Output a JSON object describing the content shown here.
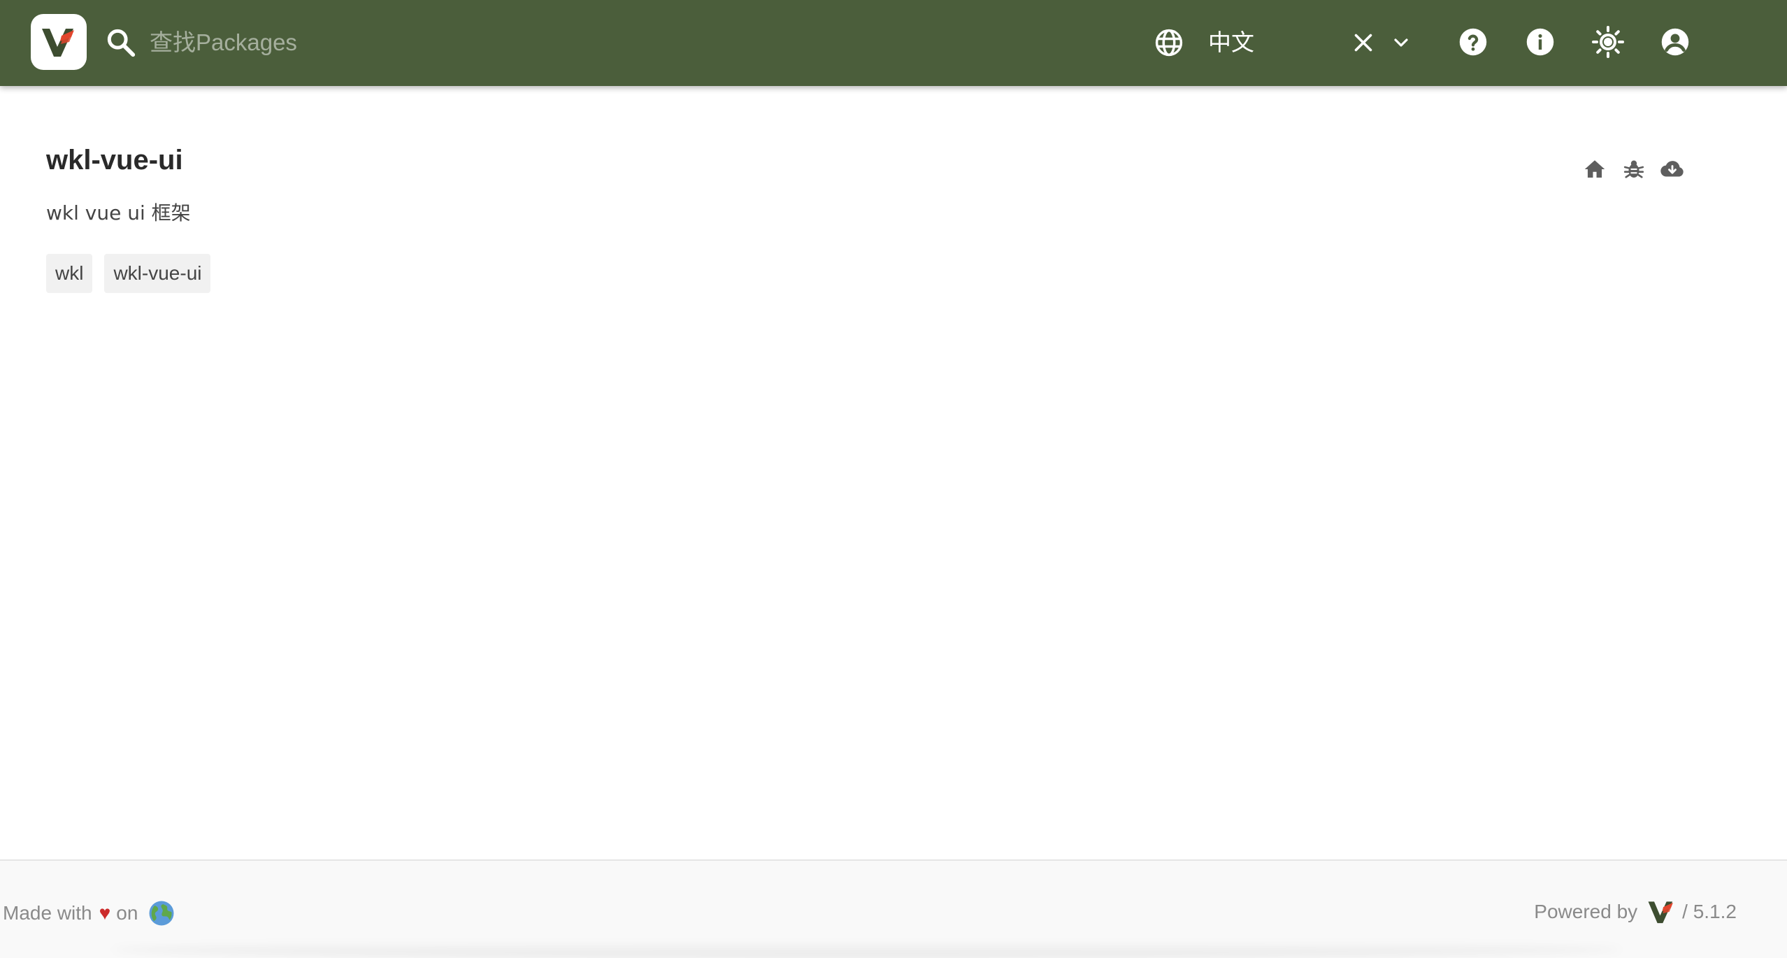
{
  "header": {
    "search_placeholder": "查找Packages",
    "language": "中文",
    "logo_icon": "verdaccio-logo-icon",
    "icons": [
      "search-icon",
      "globe-icon",
      "close-icon",
      "chevron-down-icon",
      "help-icon",
      "info-icon",
      "theme-sun-icon",
      "account-icon"
    ]
  },
  "package": {
    "name": "wkl-vue-ui",
    "description": "wkl vue ui 框架",
    "keywords": [
      "wkl",
      "wkl-vue-ui"
    ],
    "action_icons": [
      "home-icon",
      "bug-icon",
      "cloud-download-icon"
    ]
  },
  "footer": {
    "made_with": "Made with",
    "heart": "♥",
    "on": "on",
    "powered_by": "Powered by",
    "version": "/ 5.1.2"
  },
  "colors": {
    "header_bg": "#4b5e3b",
    "brand_red": "#e2452d",
    "heart": "#cc2b2b"
  }
}
